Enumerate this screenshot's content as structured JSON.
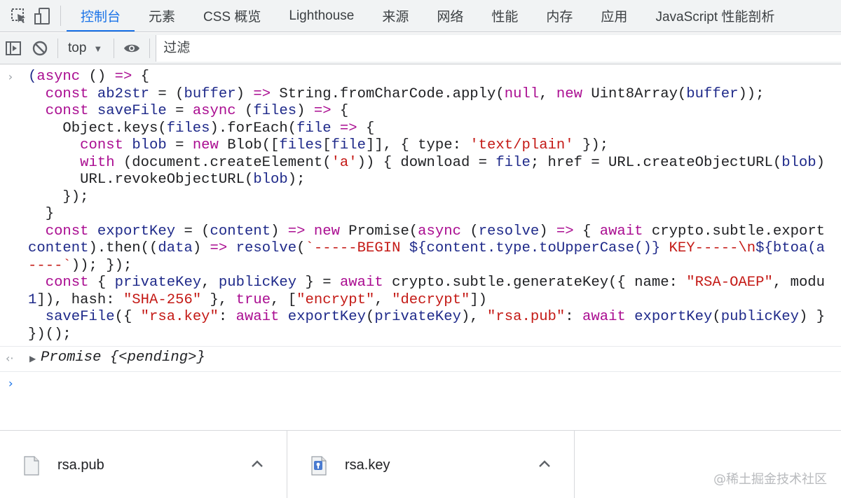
{
  "tabs": [
    {
      "label": "控制台"
    },
    {
      "label": "元素"
    },
    {
      "label": "CSS 概览"
    },
    {
      "label": "Lighthouse"
    },
    {
      "label": "来源"
    },
    {
      "label": "网络"
    },
    {
      "label": "性能"
    },
    {
      "label": "内存"
    },
    {
      "label": "应用"
    },
    {
      "label": "JavaScript 性能剖析"
    }
  ],
  "active_tab": "控制台",
  "toolbar": {
    "context": "top",
    "filter_placeholder": "过滤"
  },
  "console": {
    "input_prompt": "›",
    "result_prompt": "‹·",
    "result": "Promise {<pending>}",
    "new_prompt": "›"
  },
  "downloads": [
    {
      "name": "rsa.pub",
      "icon": "document-icon"
    },
    {
      "name": "rsa.key",
      "icon": "key-file-icon"
    }
  ],
  "watermark": "@稀土掘金技术社区",
  "colors": {
    "accent": "#1a73e8",
    "keyword": "#aa0d91",
    "string": "#c41a16",
    "name": "#1f2a8a"
  }
}
